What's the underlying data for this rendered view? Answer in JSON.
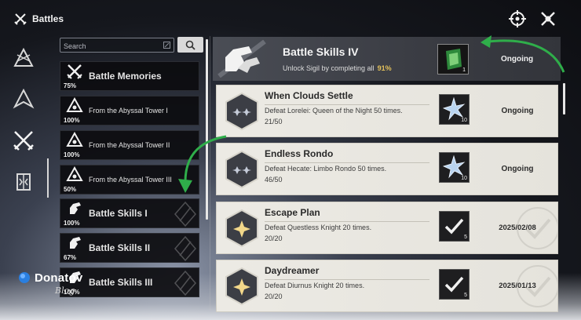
{
  "header": {
    "title": "Battles",
    "icons": [
      "battles-icon",
      "target-settings-icon",
      "close-icon"
    ],
    "accent_green": "#27a844"
  },
  "left_rail": {
    "icons": [
      "rail-icon-1",
      "rail-icon-2",
      "battles-swords-icon",
      "rail-icon-4"
    ],
    "active_index": 2
  },
  "search": {
    "placeholder": "Search"
  },
  "categories": [
    {
      "name": "Battle Memories",
      "percent": "75%",
      "icon": "swords-emblem-icon"
    },
    {
      "name": "From the Abyssal Tower I",
      "percent": "100%",
      "icon": "abyss-tower-icon"
    },
    {
      "name": "From the Abyssal Tower II",
      "percent": "100%",
      "icon": "abyss-tower-icon"
    },
    {
      "name": "From the Abyssal Tower III",
      "percent": "50%",
      "icon": "abyss-tower-icon"
    },
    {
      "name": "Battle Skills I",
      "percent": "100%",
      "icon": "gauntlet-icon"
    },
    {
      "name": "Battle Skills II",
      "percent": "67%",
      "icon": "gauntlet-icon"
    },
    {
      "name": "Battle Skills III",
      "percent": "100%",
      "icon": "gauntlet-icon"
    }
  ],
  "sigil": {
    "title": "Battle Skills IV",
    "subtitle": "Unlock Sigil by completing all",
    "percent": "91%",
    "reward_qty": "1",
    "status": "Ongoing"
  },
  "missions": [
    {
      "title": "When Clouds Settle",
      "desc": "Defeat Lorelei: Queen of the Night 50 times.",
      "progress": "21/50",
      "reward_qty": "10",
      "status": "Ongoing",
      "completed": false
    },
    {
      "title": "Endless Rondo",
      "desc": "Defeat Hecate: Limbo Rondo 50 times.",
      "progress": "46/50",
      "reward_qty": "10",
      "status": "Ongoing",
      "completed": false
    },
    {
      "title": "Escape Plan",
      "desc": "Defeat Questless Knight 20 times.",
      "progress": "20/20",
      "reward_qty": "5",
      "status": "2025/02/08",
      "completed": true
    },
    {
      "title": "Daydreamer",
      "desc": "Defeat Diurnus Knight 20 times.",
      "progress": "20/20",
      "reward_qty": "5",
      "status": "2025/01/13",
      "completed": true
    }
  ],
  "watermark": {
    "brand": "Donatov",
    "sub": "Blog"
  }
}
